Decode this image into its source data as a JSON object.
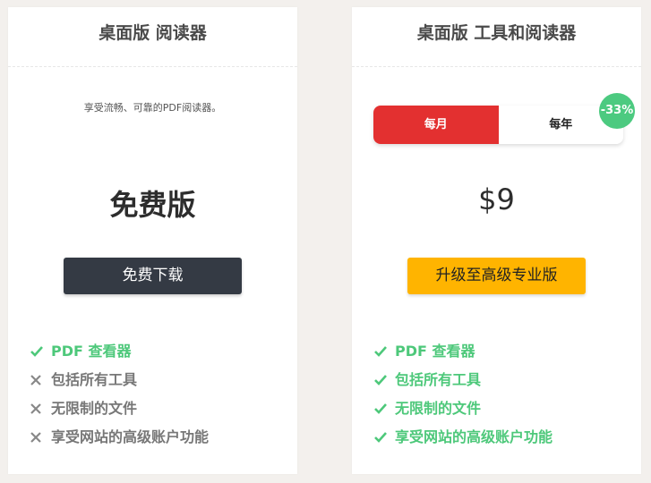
{
  "left_card": {
    "title": "桌面版 阅读器",
    "tagline": "享受流畅、可靠的PDF阅读器。",
    "plan_label": "免费版",
    "button_label": "免费下载",
    "features": [
      {
        "text": "PDF 查看器",
        "included": true
      },
      {
        "text": "包括所有工具",
        "included": false
      },
      {
        "text": "无限制的文件",
        "included": false
      },
      {
        "text": "享受网站的高级账户功能",
        "included": false
      }
    ]
  },
  "right_card": {
    "title": "桌面版 工具和阅读器",
    "toggle": {
      "monthly": "每月",
      "yearly": "每年",
      "selected": "monthly"
    },
    "discount_badge": "-33%",
    "price": "$9",
    "button_label": "升级至高级专业版",
    "features": [
      {
        "text": "PDF 查看器",
        "included": true
      },
      {
        "text": "包括所有工具",
        "included": true
      },
      {
        "text": "无限制的文件",
        "included": true
      },
      {
        "text": "享受网站的高级账户功能",
        "included": true
      }
    ]
  },
  "colors": {
    "accent_red": "#e33030",
    "accent_yellow": "#ffb400",
    "check_green": "#4dc87a",
    "dark_button": "#343a44"
  },
  "icons": {
    "included": "checkmark-icon",
    "excluded": "cross-icon"
  }
}
